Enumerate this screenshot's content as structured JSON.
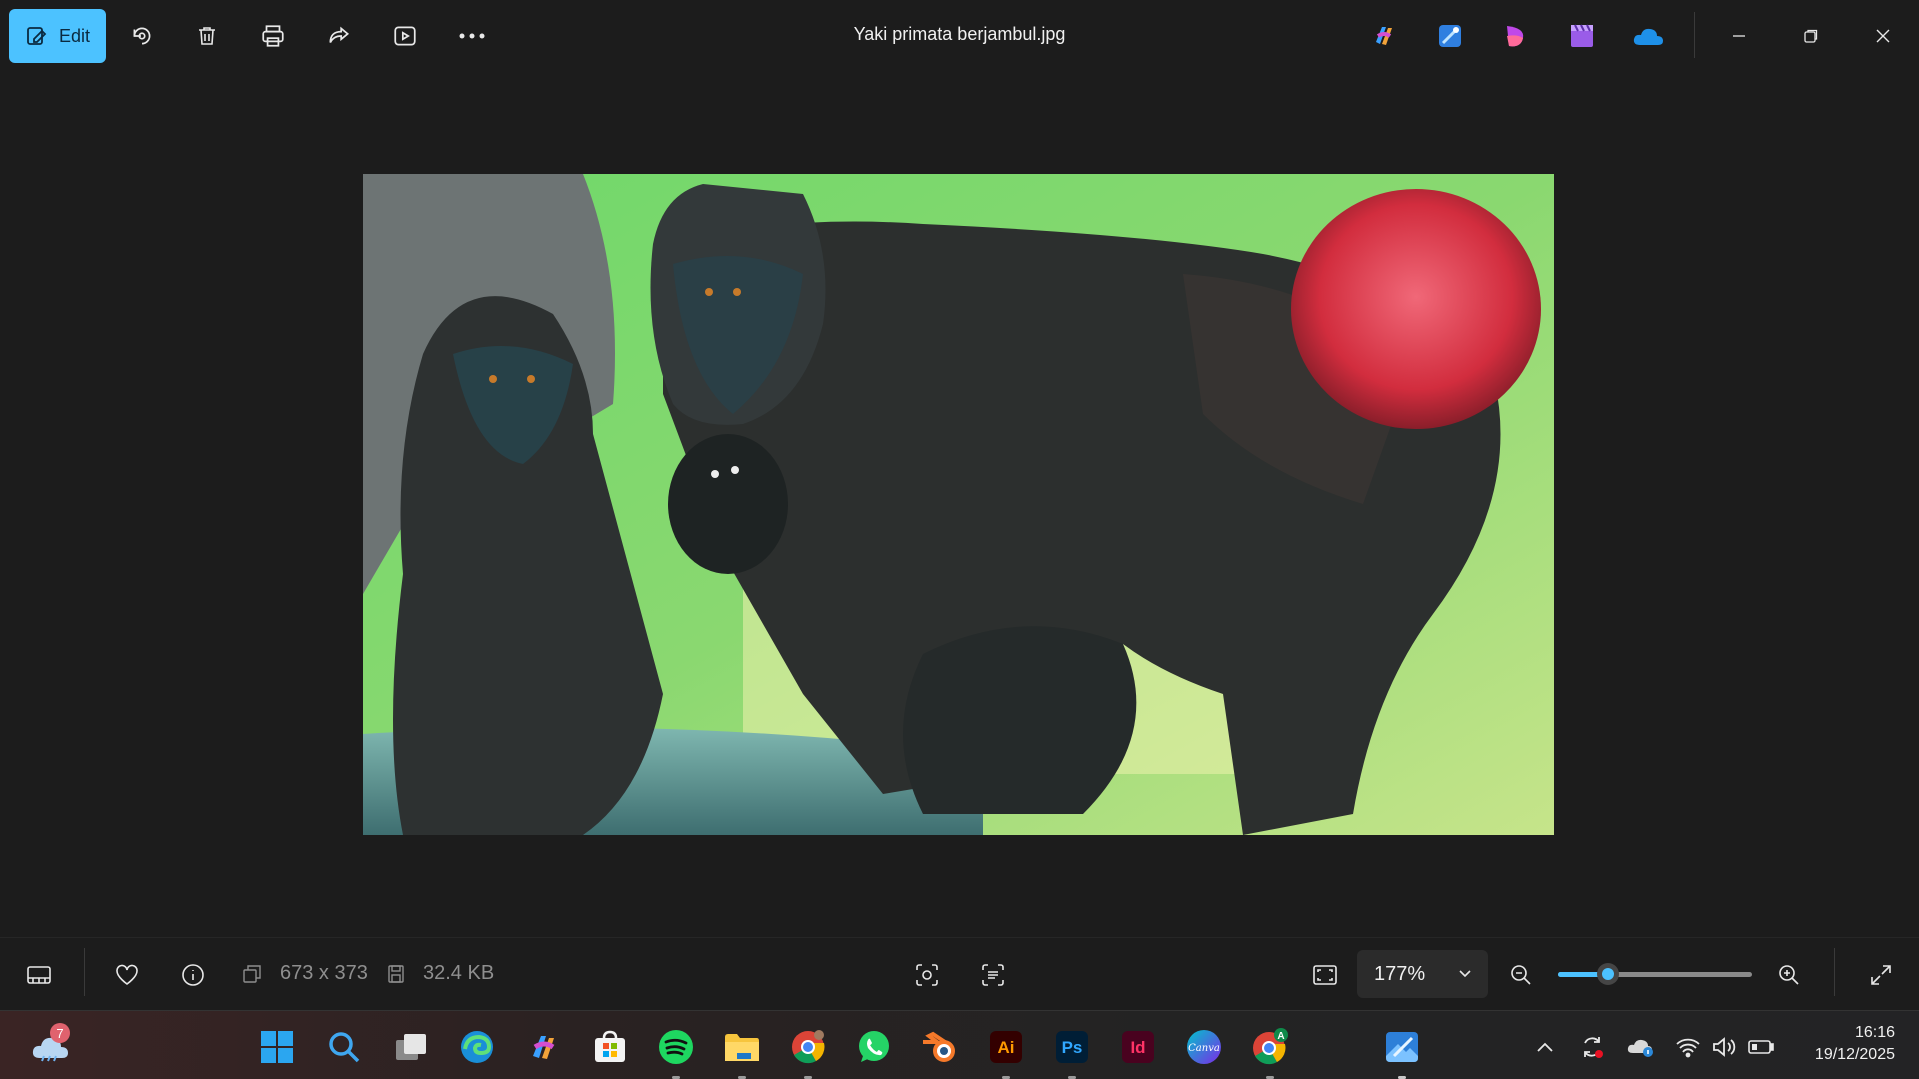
{
  "titlebar": {
    "edit_label": "Edit",
    "title": "Yaki primata berjambul.jpg",
    "tools": [
      "rotate-icon",
      "delete-icon",
      "print-icon",
      "share-icon",
      "slideshow-icon",
      "more-icon"
    ],
    "app_shortcuts": [
      "copilot-icon",
      "designer-icon",
      "clipchamp-icon",
      "video-editor-icon",
      "onedrive-icon"
    ],
    "window_controls": [
      "minimize-icon",
      "restore-icon",
      "close-icon"
    ]
  },
  "image": {
    "description_alt": "Yaki primata berjambul.jpg"
  },
  "bottombar": {
    "dimensions": "673 x 373",
    "file_size": "32.4 KB",
    "zoom_value": "177%",
    "zoom_level_fraction": 0.26
  },
  "taskbar": {
    "weather_badge": "7",
    "apps": [
      "start",
      "search",
      "task-view",
      "edge",
      "copilot",
      "store",
      "spotify",
      "file-explorer",
      "chrome",
      "whatsapp",
      "blender",
      "illustrator",
      "photoshop",
      "indesign",
      "canva",
      "chrome-profile",
      "photos"
    ],
    "ai_label": "Ai",
    "ps_label": "Ps",
    "id_label": "Id",
    "canva_label": "Canva",
    "chrome_profile_letter": "A",
    "time": "16:16",
    "date": "19/12/2025"
  },
  "colors": {
    "accent": "#4cc2ff",
    "background": "#1c1c1c"
  }
}
